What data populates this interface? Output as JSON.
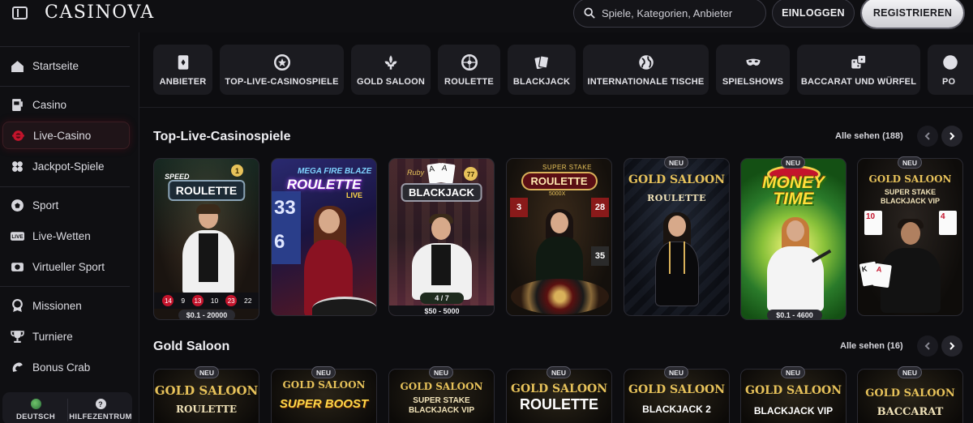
{
  "header": {
    "logo": "CASINOVA",
    "search_placeholder": "Spiele, Kategorien, Anbieter",
    "login_label": "EINLOGGEN",
    "register_label": "REGISTRIEREN"
  },
  "sidebar": {
    "items": [
      {
        "label": "Startseite",
        "icon": "home-icon"
      },
      {
        "label": "Casino",
        "icon": "slot-machine-icon"
      },
      {
        "label": "Live-Casino",
        "icon": "live-casino-icon",
        "active": true
      },
      {
        "label": "Jackpot-Spiele",
        "icon": "clover-icon"
      },
      {
        "label": "Sport",
        "icon": "soccer-ball-icon"
      },
      {
        "label": "Live-Wetten",
        "icon": "live-badge-icon"
      },
      {
        "label": "Virtueller Sport",
        "icon": "virtual-sport-icon"
      },
      {
        "label": "Missionen",
        "icon": "medal-icon"
      },
      {
        "label": "Turniere",
        "icon": "trophy-icon"
      },
      {
        "label": "Bonus Crab",
        "icon": "crab-claw-icon"
      }
    ],
    "language_label": "DEUTSCH",
    "help_label": "HILFEZENTRUM"
  },
  "categories": [
    {
      "label": "ANBIETER",
      "icon": "card-deck-icon"
    },
    {
      "label": "TOP-LIVE-CASINOSPIELE",
      "icon": "chip-star-icon"
    },
    {
      "label": "GOLD SALOON",
      "icon": "fleur-de-lis-icon"
    },
    {
      "label": "ROULETTE",
      "icon": "roulette-wheel-icon"
    },
    {
      "label": "BLACKJACK",
      "icon": "playing-cards-icon"
    },
    {
      "label": "INTERNATIONALE TISCHE",
      "icon": "globe-icon"
    },
    {
      "label": "SPIELSHOWS",
      "icon": "mask-icon"
    },
    {
      "label": "BACCARAT UND WÜRFEL",
      "icon": "dice-icon"
    },
    {
      "label": "PO",
      "icon": "poker-icon"
    }
  ],
  "sections": [
    {
      "title": "Top-Live-Casinospiele",
      "see_all": "Alle sehen (188)",
      "games": [
        {
          "title": "ROULETTE",
          "subtitle": "SPEED",
          "badge": "",
          "price": "$0.1 - 20000",
          "numbers": [
            "14",
            "9",
            "13",
            "10",
            "23",
            "22"
          ]
        },
        {
          "title": "ROULETTE",
          "subtitle": "MEGA FIRE BLAZE",
          "extra": "LIVE",
          "badge": "",
          "price": ""
        },
        {
          "title": "BLACKJACK",
          "subtitle": "Ruby",
          "badge": "",
          "price": "$50 - 5000",
          "seats": "4 / 7",
          "chip": "77"
        },
        {
          "title": "ROULETTE",
          "subtitle": "SUPER STAKE",
          "extra": "5000X",
          "badge": "",
          "price": "",
          "numbers": [
            "3",
            "28",
            "35"
          ]
        },
        {
          "title": "GOLD SALOON",
          "subtitle": "ROULETTE",
          "badge": "NEU",
          "price": ""
        },
        {
          "title": "MONEY TIME",
          "subtitle": "",
          "badge": "NEU",
          "price": "$0.1 - 4600"
        },
        {
          "title": "GOLD SALOON",
          "subtitle": "SUPER STAKE BLACKJACK VIP",
          "badge": "NEU",
          "price": ""
        }
      ]
    },
    {
      "title": "Gold Saloon",
      "see_all": "Alle sehen (16)",
      "games": [
        {
          "title": "GOLD SALOON",
          "subtitle": "ROULETTE",
          "badge": "NEU"
        },
        {
          "title": "GOLD SALOON",
          "subtitle": "SUPER BOOST",
          "badge": "NEU"
        },
        {
          "title": "GOLD SALOON",
          "subtitle": "SUPER STAKE BLACKJACK VIP",
          "badge": "NEU"
        },
        {
          "title": "GOLD SALOON",
          "subtitle": "ROULETTE",
          "badge": "NEU"
        },
        {
          "title": "GOLD SALOON",
          "subtitle": "BLACKJACK 2",
          "badge": "NEU"
        },
        {
          "title": "GOLD SALOON",
          "subtitle": "BLACKJACK VIP",
          "badge": "NEU"
        },
        {
          "title": "GOLD SALOON",
          "subtitle": "BACCARAT",
          "badge": "NEU"
        }
      ]
    }
  ],
  "colors": {
    "background": "#0d0d10",
    "accent_red": "#c4142c",
    "gold": "#d9b15a"
  }
}
